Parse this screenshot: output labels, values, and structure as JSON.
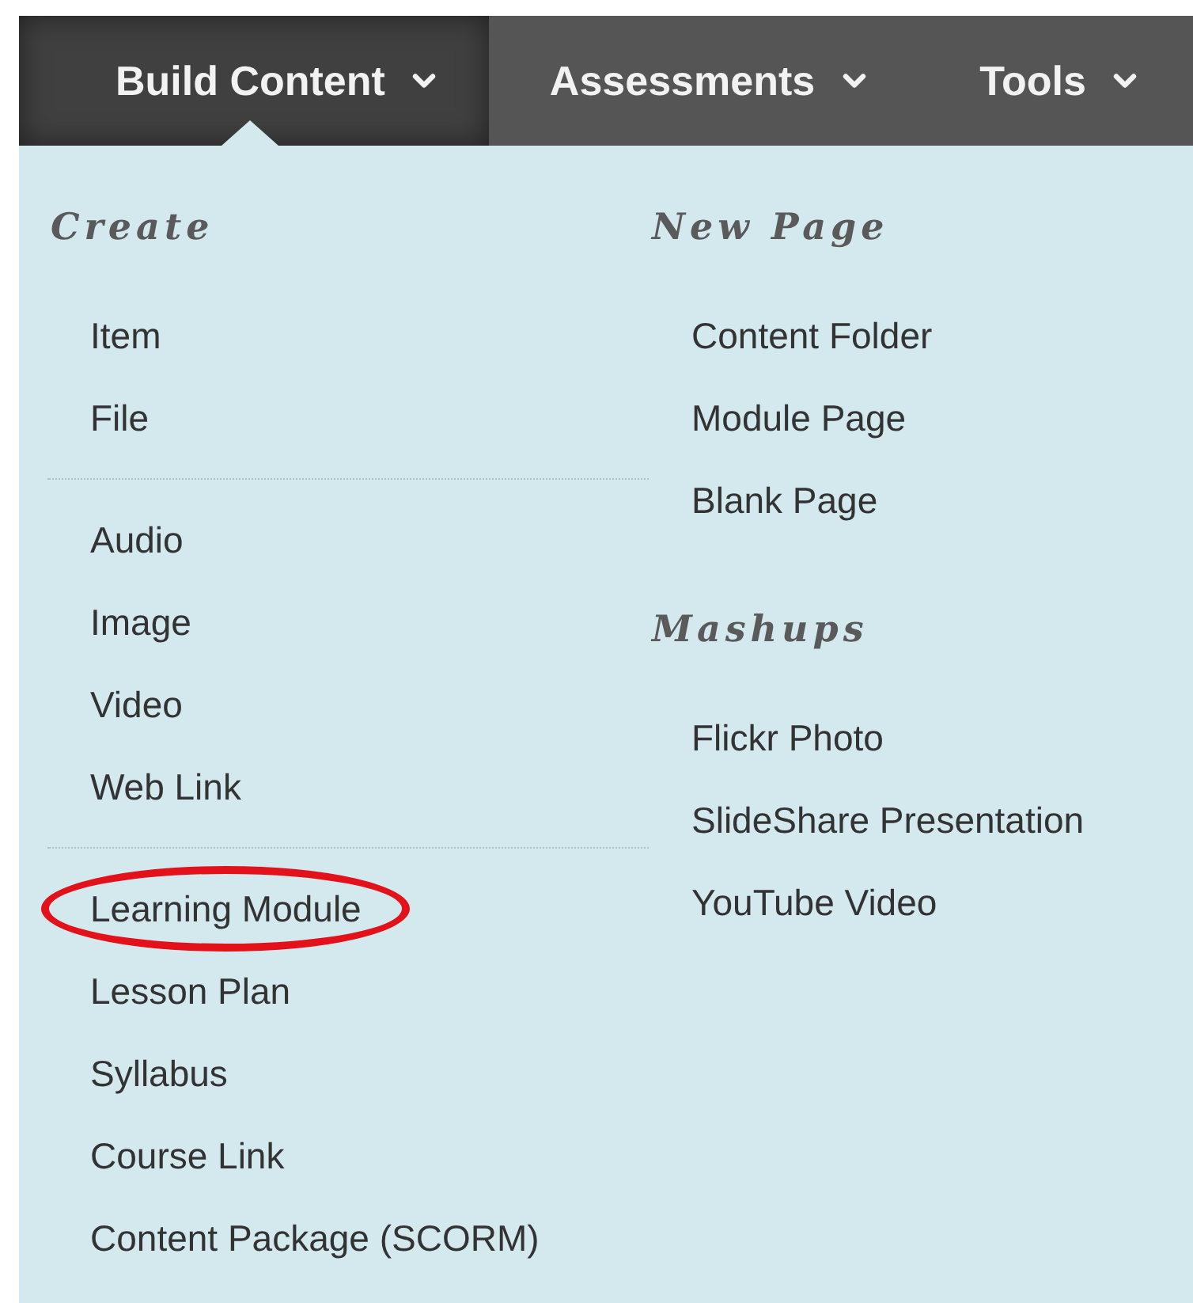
{
  "menu_bar": {
    "tabs": [
      {
        "label": "Build Content",
        "selected": true
      },
      {
        "label": "Assessments",
        "selected": false
      },
      {
        "label": "Tools",
        "selected": false
      }
    ]
  },
  "dropdown": {
    "columns": [
      {
        "sections": [
          {
            "heading": "Create",
            "groups": [
              {
                "items": [
                  {
                    "label": "Item",
                    "circled": false
                  },
                  {
                    "label": "File",
                    "circled": false
                  }
                ]
              },
              {
                "items": [
                  {
                    "label": "Audio",
                    "circled": false
                  },
                  {
                    "label": "Image",
                    "circled": false
                  },
                  {
                    "label": "Video",
                    "circled": false
                  },
                  {
                    "label": "Web Link",
                    "circled": false
                  }
                ]
              },
              {
                "items": [
                  {
                    "label": "Learning Module",
                    "circled": true
                  },
                  {
                    "label": "Lesson Plan",
                    "circled": false
                  },
                  {
                    "label": "Syllabus",
                    "circled": false
                  },
                  {
                    "label": "Course Link",
                    "circled": false
                  },
                  {
                    "label": "Content Package (SCORM)",
                    "circled": false
                  }
                ]
              }
            ]
          }
        ]
      },
      {
        "sections": [
          {
            "heading": "New Page",
            "groups": [
              {
                "items": [
                  {
                    "label": "Content Folder",
                    "circled": false
                  },
                  {
                    "label": "Module Page",
                    "circled": false
                  },
                  {
                    "label": "Blank Page",
                    "circled": false
                  }
                ]
              }
            ]
          },
          {
            "heading": "Mashups",
            "groups": [
              {
                "items": [
                  {
                    "label": "Flickr Photo",
                    "circled": false
                  },
                  {
                    "label": "SlideShare Presentation",
                    "circled": false
                  },
                  {
                    "label": "YouTube Video",
                    "circled": false
                  }
                ]
              }
            ]
          }
        ]
      }
    ]
  }
}
